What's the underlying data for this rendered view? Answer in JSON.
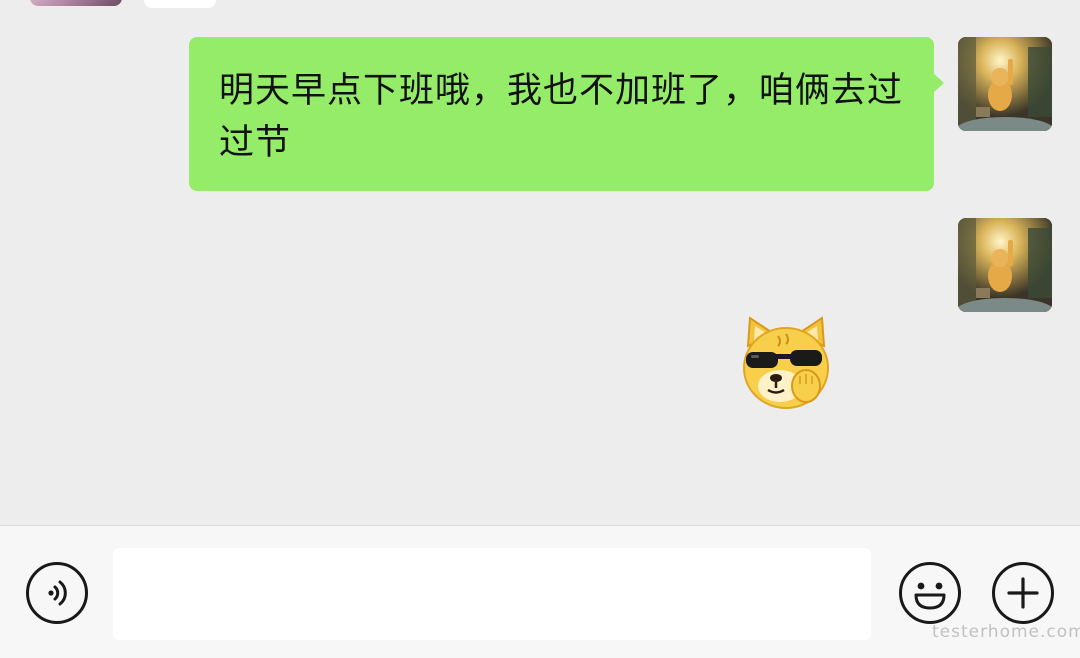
{
  "chat": {
    "messages": [
      {
        "sender": "self",
        "type": "text",
        "text": "明天早点下班哦，我也不加班了，咱俩去过过节"
      },
      {
        "sender": "self",
        "type": "sticker",
        "sticker": "doge-sunglasses-sticker"
      }
    ],
    "bubble_color": "#95ec69",
    "background_color": "#ededed"
  },
  "input_bar": {
    "voice_icon": "voice-icon",
    "emoji_icon": "emoji-icon",
    "plus_icon": "plus-icon",
    "input_value": "",
    "input_placeholder": ""
  },
  "watermark": {
    "text": "testerhome.com"
  }
}
